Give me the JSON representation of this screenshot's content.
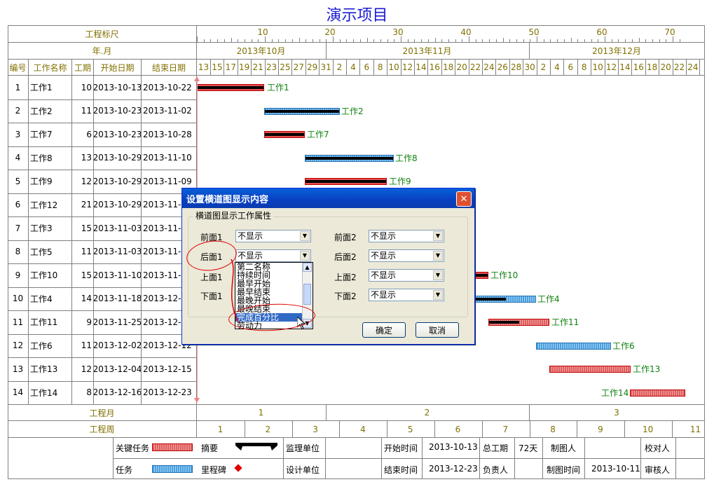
{
  "title": "演示项目",
  "header": {
    "scale_label": "工程标尺",
    "yearmonth_label": "年.月",
    "scale_ticks": [
      "10",
      "20",
      "30",
      "40",
      "50",
      "60",
      "70"
    ],
    "months": [
      "2013年10月",
      "2013年11月",
      "2013年12月"
    ],
    "days": [
      "13",
      "15",
      "17",
      "19",
      "21",
      "23",
      "25",
      "27",
      "29",
      "31",
      "2",
      "4",
      "6",
      "8",
      "10",
      "12",
      "14",
      "16",
      "18",
      "20",
      "22",
      "24",
      "26",
      "28",
      "30",
      "2",
      "4",
      "6",
      "8",
      "10",
      "12",
      "14",
      "16",
      "18",
      "20",
      "22",
      "24"
    ],
    "columns": {
      "id": "编号",
      "name": "工作名称",
      "duration": "工期",
      "start": "开始日期",
      "end": "结束日期"
    }
  },
  "tasks": [
    {
      "id": "1",
      "name": "工作1",
      "duration": "10",
      "start": "2013-10-13",
      "end": "2013-10-22",
      "label": "工作1"
    },
    {
      "id": "2",
      "name": "工作2",
      "duration": "11",
      "start": "2013-10-23",
      "end": "2013-11-02",
      "label": "工作2"
    },
    {
      "id": "3",
      "name": "工作7",
      "duration": "6",
      "start": "2013-10-23",
      "end": "2013-10-28",
      "label": "工作7"
    },
    {
      "id": "4",
      "name": "工作8",
      "duration": "13",
      "start": "2013-10-29",
      "end": "2013-11-10",
      "label": "工作8"
    },
    {
      "id": "5",
      "name": "工作9",
      "duration": "12",
      "start": "2013-10-29",
      "end": "2013-11-09",
      "label": "工作9"
    },
    {
      "id": "6",
      "name": "工作12",
      "duration": "21",
      "start": "2013-10-29",
      "end": "2013-11-1",
      "label": ""
    },
    {
      "id": "7",
      "name": "工作3",
      "duration": "15",
      "start": "2013-11-03",
      "end": "2013-11-1",
      "label": ""
    },
    {
      "id": "8",
      "name": "工作5",
      "duration": "11",
      "start": "2013-11-03",
      "end": "2013-11-1",
      "label": ""
    },
    {
      "id": "9",
      "name": "工作10",
      "duration": "15",
      "start": "2013-11-10",
      "end": "2013-11-2",
      "label": "工作10"
    },
    {
      "id": "10",
      "name": "工作4",
      "duration": "14",
      "start": "2013-11-18",
      "end": "2013-12-0",
      "label": "工作4"
    },
    {
      "id": "11",
      "name": "工作11",
      "duration": "9",
      "start": "2013-11-25",
      "end": "2013-12-0",
      "label": "工作11"
    },
    {
      "id": "12",
      "name": "工作6",
      "duration": "11",
      "start": "2013-12-02",
      "end": "2013-12-12",
      "label": "工作6"
    },
    {
      "id": "13",
      "name": "工作13",
      "duration": "12",
      "start": "2013-12-04",
      "end": "2013-12-15",
      "label": "工作13"
    },
    {
      "id": "14",
      "name": "工作14",
      "duration": "8",
      "start": "2013-12-16",
      "end": "2013-12-23",
      "label": "工作14"
    }
  ],
  "footer": {
    "month_label": "工程月",
    "week_label": "工程周",
    "months": [
      "1",
      "2",
      "3"
    ],
    "weeks": [
      "1",
      "2",
      "3",
      "4",
      "5",
      "6",
      "7",
      "8",
      "9",
      "10",
      "11"
    ]
  },
  "legend": {
    "critical": "关键任务",
    "summary": "摘要",
    "task": "任务",
    "milestone": "里程碑",
    "supervisor": "监理单位",
    "designer": "设计单位",
    "start_time_label": "开始时间",
    "start_time": "2013-10-13",
    "end_time_label": "结束时间",
    "end_time": "2013-12-23",
    "total_label": "总工期",
    "total": "72天",
    "owner_label": "负责人",
    "drawer_label": "制图人",
    "draw_time_label": "制图时间",
    "draw_time": "2013-10-11",
    "checker_label": "校对人",
    "reviewer_label": "审核人"
  },
  "dialog": {
    "title": "设置横道图显示内容",
    "close": "✕",
    "group": "横道图显示工作属性",
    "front1_label": "前面1",
    "front1_value": "不显示",
    "back1_label": "后面1",
    "back1_value": "不显示",
    "top1_label": "上面1",
    "bottom1_label": "下面1",
    "front2_label": "前面2",
    "front2_value": "不显示",
    "back2_label": "后面2",
    "back2_value": "不显示",
    "top2_label": "上面2",
    "top2_value": "不显示",
    "bottom2_label": "下面2",
    "bottom2_value": "不显示",
    "dropdown_items": [
      "第二名称",
      "持续时间",
      "最早开始",
      "最早结束",
      "最晚开始",
      "最晚结束",
      "完成百分比",
      "劳动力"
    ],
    "selected_item": "完成百分比",
    "ok": "确定",
    "cancel": "取消"
  },
  "colors": {
    "title": "#1a1ad6",
    "header_text": "#807000",
    "label_text": "#108010",
    "critical": "#e05050",
    "task": "#4aa0e0"
  }
}
